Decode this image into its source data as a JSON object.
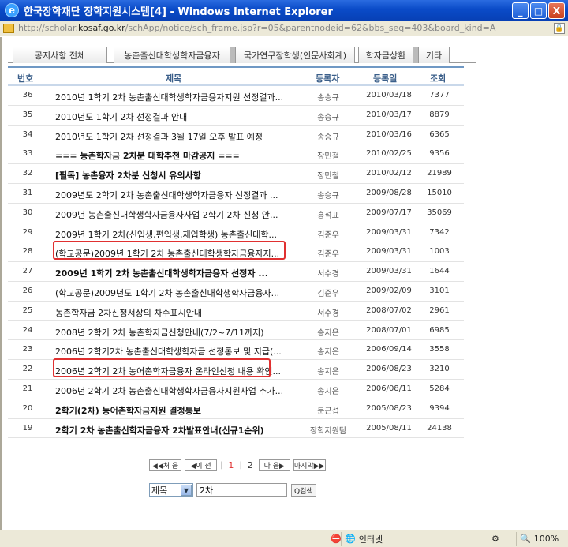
{
  "window": {
    "title": "한국장학재단 장학지원시스템[4] - Windows Internet Explorer",
    "url_host": "http://scholar.",
    "url_domain": "kosaf.go.kr",
    "url_path": "/schApp/notice/sch_frame.jsp?r=05&parentnodeid=62&bbs_seq=403&board_kind=A",
    "btn_minimize": "_",
    "btn_maximize": "□",
    "btn_close": "X"
  },
  "tabs": [
    {
      "label": "공지사항 전체"
    },
    {
      "label": "농촌출신대학생학자금융자"
    },
    {
      "label": "국가연구장학생(인문사회계)"
    },
    {
      "label": "학자금상환"
    },
    {
      "label": "기타"
    }
  ],
  "table": {
    "headers": {
      "no": "번호",
      "title": "제목",
      "author": "등록자",
      "date": "등록일",
      "views": "조회"
    },
    "rows": [
      {
        "no": "36",
        "title": "2010년 1학기 2차 농촌출신대학생학자금융자지원 선정결과...",
        "author": "송승규",
        "date": "2010/03/18",
        "views": "7377",
        "bold": false
      },
      {
        "no": "35",
        "title": "2010년도 1학기 2차 선정결과 안내",
        "author": "송승규",
        "date": "2010/03/17",
        "views": "8879",
        "bold": false
      },
      {
        "no": "34",
        "title": "2010년도 1학기 2차 선정결과 3월 17일 오후 발표 예정",
        "author": "송승규",
        "date": "2010/03/16",
        "views": "6365",
        "bold": false
      },
      {
        "no": "33",
        "title": "=== 농촌학자금 2차분 대학추천 마감공지 ===",
        "author": "장민철",
        "date": "2010/02/25",
        "views": "9356",
        "bold": true
      },
      {
        "no": "32",
        "title": "[필독] 농촌융자 2차분 신청시 유의사항",
        "author": "장민철",
        "date": "2010/02/12",
        "views": "21989",
        "bold": true
      },
      {
        "no": "31",
        "title": "2009년도 2학기 2차 농촌출신대학생학자금융자 선정결과 ...",
        "author": "송승규",
        "date": "2009/08/28",
        "views": "15010",
        "bold": false
      },
      {
        "no": "30",
        "title": "2009년 농촌출신대학생학자금융자사업 2학기 2차 신청 안...",
        "author": "홍석표",
        "date": "2009/07/17",
        "views": "35069",
        "bold": false
      },
      {
        "no": "29",
        "title": "2009년 1학기 2차(신입생,편입생,재입학생) 농촌출신대학...",
        "author": "김준우",
        "date": "2009/03/31",
        "views": "7342",
        "bold": false
      },
      {
        "no": "28",
        "title": "(학교공문)2009년 1학기 2차 농촌출신대학생학자금융자지...",
        "author": "김준우",
        "date": "2009/03/31",
        "views": "1003",
        "bold": false
      },
      {
        "no": "27",
        "title": "2009년 1학기 2차 농촌출신대학생학자금융자 선정자 ...",
        "author": "서수경",
        "date": "2009/03/31",
        "views": "1644",
        "bold": true
      },
      {
        "no": "26",
        "title": "(학교공문)2009년도 1학기 2차 농촌출신대학생학자금융자...",
        "author": "김준우",
        "date": "2009/02/09",
        "views": "3101",
        "bold": false
      },
      {
        "no": "25",
        "title": "농촌학자금 2차신청서상의 차수표시안내",
        "author": "서수경",
        "date": "2008/07/02",
        "views": "2961",
        "bold": false
      },
      {
        "no": "24",
        "title": "2008년 2학기 2차 농촌학자금신청안내(7/2~7/11까지)",
        "author": "송지은",
        "date": "2008/07/01",
        "views": "6985",
        "bold": false
      },
      {
        "no": "23",
        "title": "2006년 2학기2차 농촌출신대학생학자금 선정통보 및 지급(...",
        "author": "송지은",
        "date": "2006/09/14",
        "views": "3558",
        "bold": false
      },
      {
        "no": "22",
        "title": "2006년 2학기 2차 농어촌학자금융자 온라인신청 내용 확인...",
        "author": "송지은",
        "date": "2006/08/23",
        "views": "3210",
        "bold": false
      },
      {
        "no": "21",
        "title": "2006년 2학기 2차 농촌출신대학생학자금융자지원사업 추가...",
        "author": "송지은",
        "date": "2006/08/11",
        "views": "5284",
        "bold": false
      },
      {
        "no": "20",
        "title": "2학기(2차) 농어촌학자금지원 결정통보",
        "author": "문근섭",
        "date": "2005/08/23",
        "views": "9394",
        "bold": true
      },
      {
        "no": "19",
        "title": "2학기 2차 농촌출신학자금융자 2차발표안내(신규1순위)",
        "author": "장학지원팀",
        "date": "2005/08/11",
        "views": "24138",
        "bold": true
      }
    ]
  },
  "pager": {
    "first": "◀◀처 음",
    "prev": "◀이 전",
    "sep": "|",
    "pages": [
      "1",
      "2"
    ],
    "current": "1",
    "next": "다 음▶",
    "last": "마지막▶▶"
  },
  "search": {
    "field_selected": "제목",
    "keyword": "2차",
    "button": "Q검색"
  },
  "status": {
    "zone": "인터넷",
    "zoom": "100%"
  },
  "colors": {
    "highlight": "#e03030",
    "header_text": "#3b5f8a",
    "titlebar": "#0a4bc8"
  }
}
